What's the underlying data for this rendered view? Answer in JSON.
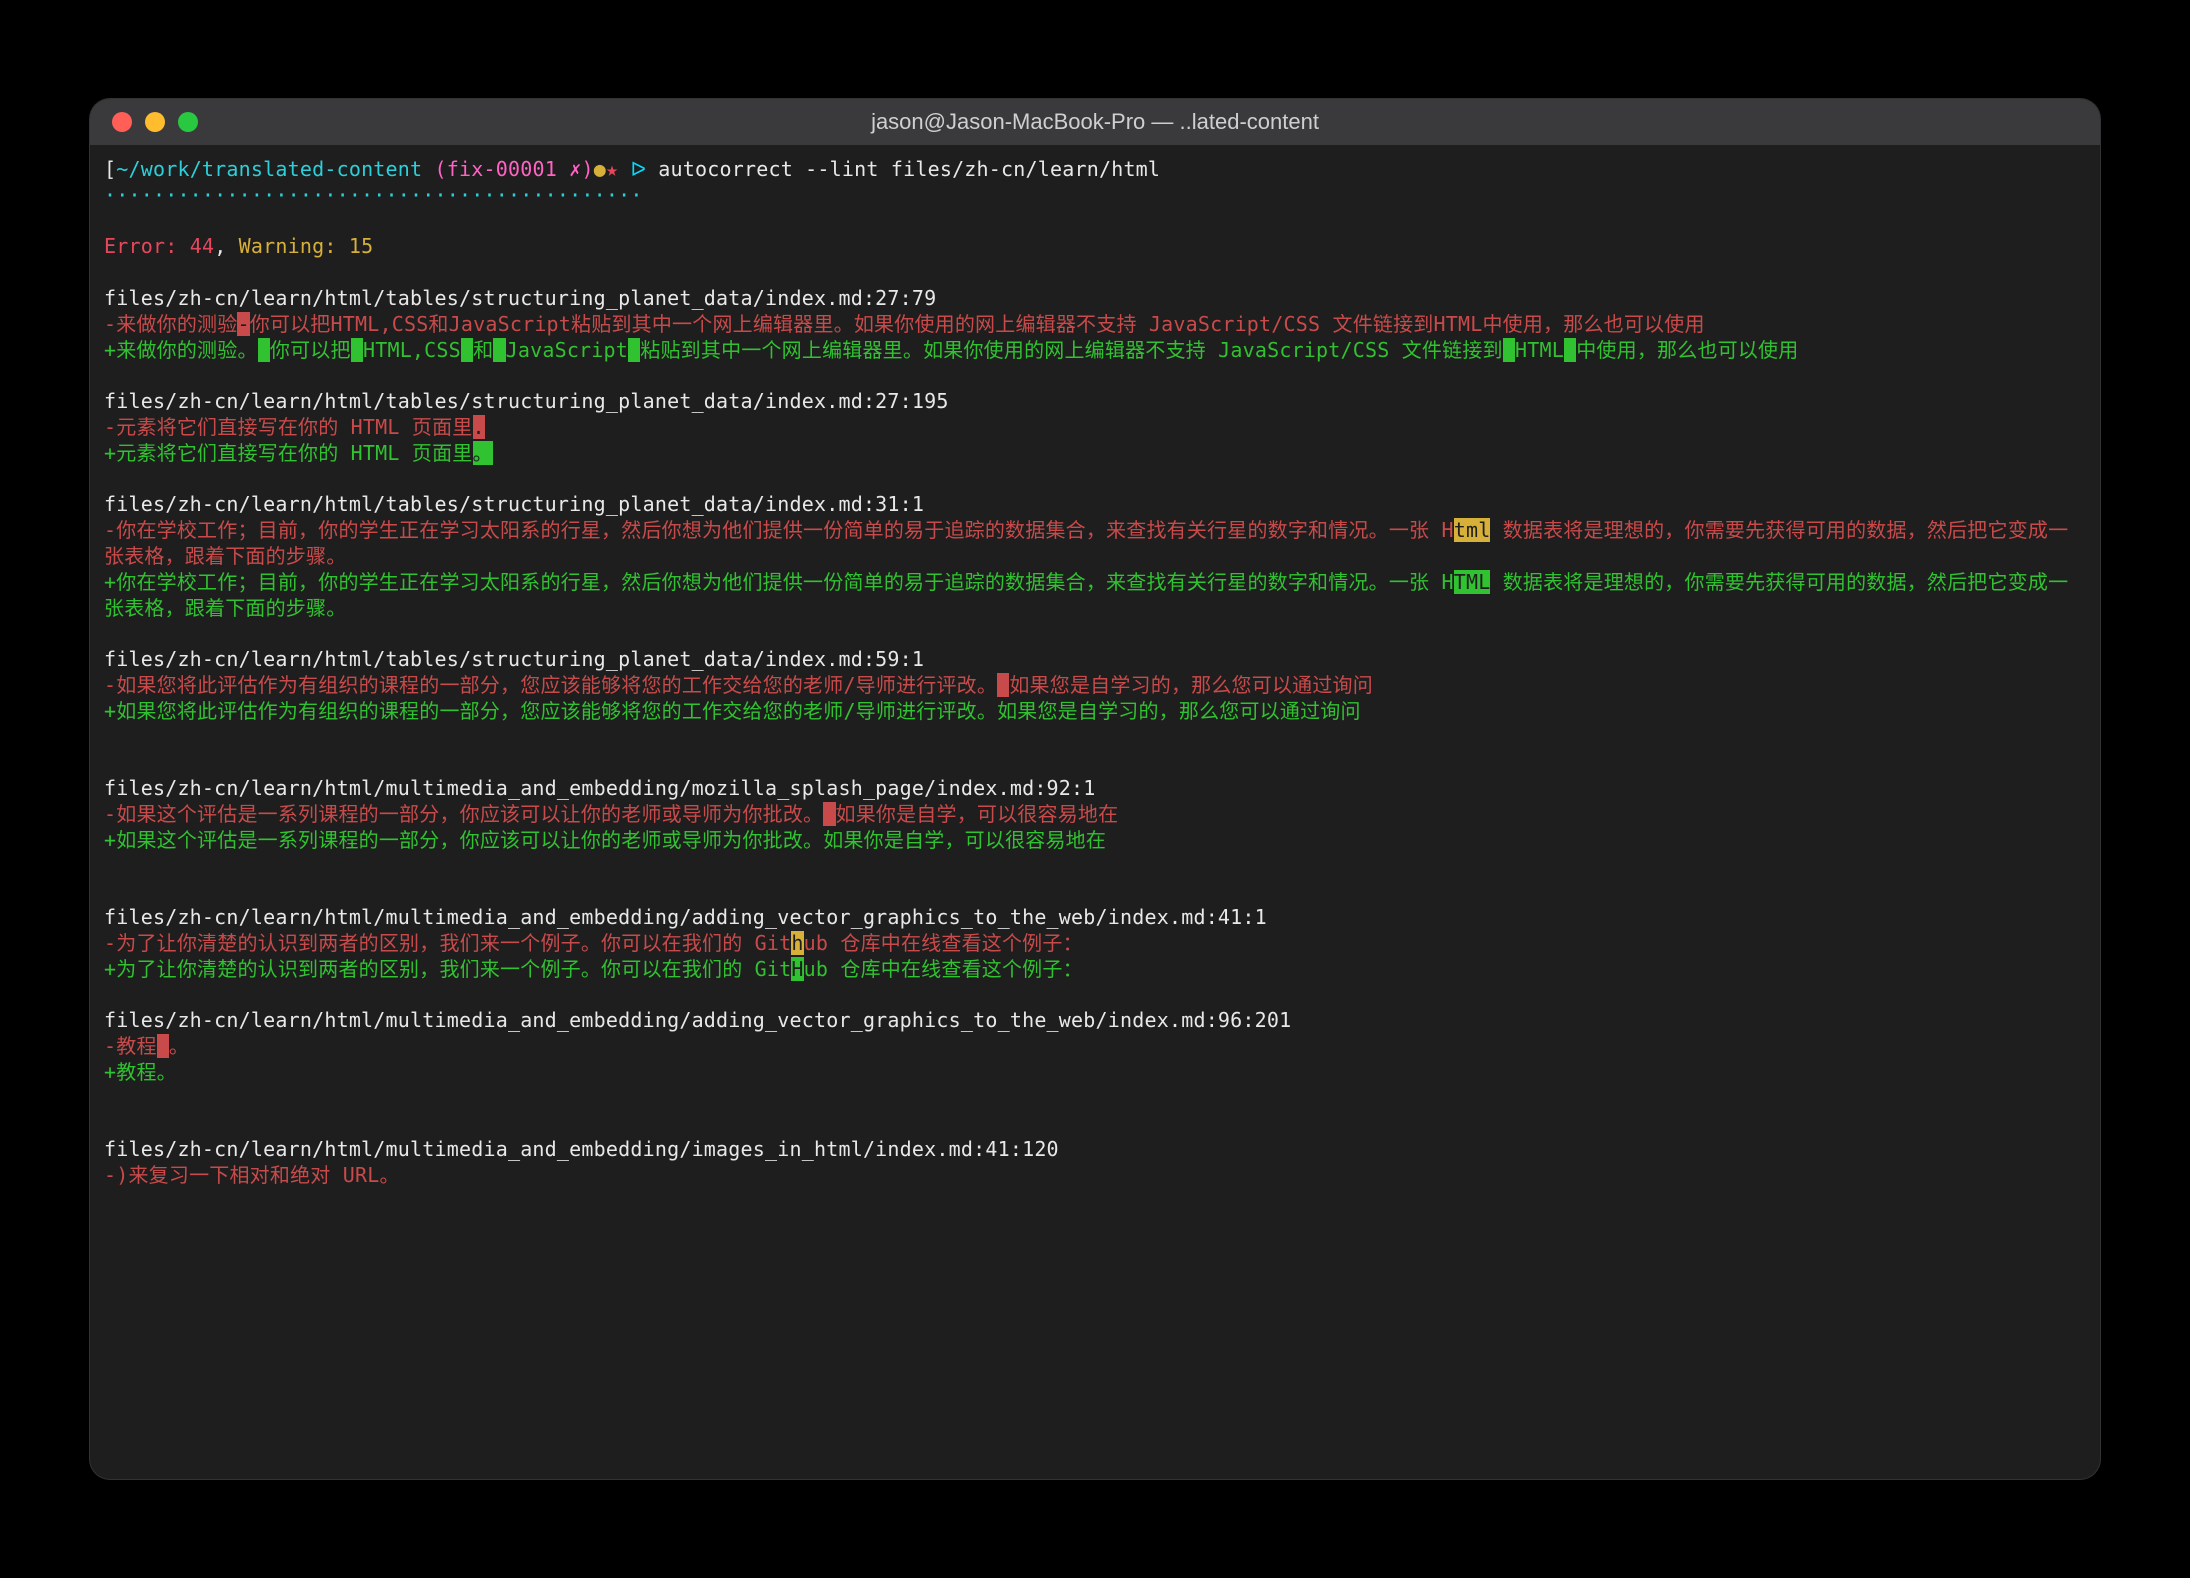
{
  "window": {
    "title": "jason@Jason-MacBook-Pro — ..lated-content"
  },
  "prompt": {
    "path": "~/work/translated-content",
    "branch": "(fix-00001 ",
    "x": "✗",
    "branch_close": ")",
    "star1": "●",
    "star2": "★",
    "arrow": "ᐅ",
    "command": "autocorrect --lint files/zh-cn/learn/html"
  },
  "dots": "············································",
  "summary": {
    "error_label": "Error:",
    "error_count": "44",
    "comma": ",",
    "warning_label": "Warning:",
    "warning_count": "15"
  },
  "blocks": [
    {
      "file": "files/zh-cn/learn/html/tables/structuring_planet_data/index.md:27:79",
      "del": [
        {
          "t": "-来做你的测验"
        },
        {
          "t": "-",
          "hl": "red"
        },
        {
          "t": "你可以把HTML,CSS和JavaScript粘贴到其中一个网上编辑器里。如果你使用的网上编辑器不支持 JavaScript/CSS 文件链接到HTML中使用，那么也可以使用"
        }
      ],
      "add": [
        {
          "t": "+来做你的测验。"
        },
        {
          "t": " ",
          "hl": "green"
        },
        {
          "t": "你可以把"
        },
        {
          "t": " ",
          "hl": "green"
        },
        {
          "t": "HTML,CSS"
        },
        {
          "t": " ",
          "hl": "green"
        },
        {
          "t": "和"
        },
        {
          "t": " ",
          "hl": "green"
        },
        {
          "t": "JavaScript"
        },
        {
          "t": " ",
          "hl": "green"
        },
        {
          "t": "粘贴到其中一个网上编辑器里。如果你使用的网上编辑器不支持 JavaScript/CSS 文件链接到"
        },
        {
          "t": " ",
          "hl": "green"
        },
        {
          "t": "HTML"
        },
        {
          "t": " ",
          "hl": "green"
        },
        {
          "t": "中使用，那么也可以使用"
        }
      ]
    },
    {
      "file": "files/zh-cn/learn/html/tables/structuring_planet_data/index.md:27:195",
      "del": [
        {
          "t": "-元素将它们直接写在你的 HTML 页面里"
        },
        {
          "t": ".",
          "hl": "red"
        }
      ],
      "add": [
        {
          "t": "+元素将它们直接写在你的 HTML 页面里"
        },
        {
          "t": "。",
          "hl": "green"
        }
      ]
    },
    {
      "file": "files/zh-cn/learn/html/tables/structuring_planet_data/index.md:31:1",
      "del": [
        {
          "t": "-你在学校工作；目前，你的学生正在学习太阳系的行星，然后你想为他们提供一份简单的易于追踪的数据集合，来查找有关行星的数字和情况。一张 H"
        },
        {
          "t": "tml",
          "hl": "yel"
        },
        {
          "t": " 数据表将是理想的，你需要先获得可用的数据，然后把它变成一张表格，跟着下面的步骤。"
        }
      ],
      "add": [
        {
          "t": "+你在学校工作；目前，你的学生正在学习太阳系的行星，然后你想为他们提供一份简单的易于追踪的数据集合，来查找有关行星的数字和情况。一张 H"
        },
        {
          "t": "TML",
          "hl": "green"
        },
        {
          "t": " 数据表将是理想的，你需要先获得可用的数据，然后把它变成一张表格，跟着下面的步骤。"
        }
      ]
    },
    {
      "file": "files/zh-cn/learn/html/tables/structuring_planet_data/index.md:59:1",
      "del": [
        {
          "t": "-如果您将此评估作为有组织的课程的一部分，您应该能够将您的工作交给您的老师/导师进行评改。"
        },
        {
          "t": " ",
          "hl": "red"
        },
        {
          "t": "如果您是自学习的，那么您可以通过询问"
        }
      ],
      "add": [
        {
          "t": "+如果您将此评估作为有组织的课程的一部分，您应该能够将您的工作交给您的老师/导师进行评改。如果您是自学习的，那么您可以通过询问"
        }
      ]
    },
    {
      "file": "files/zh-cn/learn/html/multimedia_and_embedding/mozilla_splash_page/index.md:92:1",
      "del": [
        {
          "t": "-如果这个评估是一系列课程的一部分，你应该可以让你的老师或导师为你批改。"
        },
        {
          "t": " ",
          "hl": "red"
        },
        {
          "t": "如果你是自学，可以很容易地在"
        }
      ],
      "add": [
        {
          "t": "+如果这个评估是一系列课程的一部分，你应该可以让你的老师或导师为你批改。如果你是自学，可以很容易地在"
        }
      ]
    },
    {
      "file": "files/zh-cn/learn/html/multimedia_and_embedding/adding_vector_graphics_to_the_web/index.md:41:1",
      "del": [
        {
          "t": "-为了让你清楚的认识到两者的区别，我们来一个例子。你可以在我们的 Git"
        },
        {
          "t": "h",
          "hl": "yel"
        },
        {
          "t": "ub 仓库中在线查看这个例子："
        }
      ],
      "add": [
        {
          "t": "+为了让你清楚的认识到两者的区别，我们来一个例子。你可以在我们的 Git"
        },
        {
          "t": "H",
          "hl": "green"
        },
        {
          "t": "ub 仓库中在线查看这个例子："
        }
      ]
    },
    {
      "file": "files/zh-cn/learn/html/multimedia_and_embedding/adding_vector_graphics_to_the_web/index.md:96:201",
      "del": [
        {
          "t": "-教程"
        },
        {
          "t": " ",
          "hl": "red"
        },
        {
          "t": "。"
        }
      ],
      "add": [
        {
          "t": "+教程。"
        }
      ]
    },
    {
      "file": "files/zh-cn/learn/html/multimedia_and_embedding/images_in_html/index.md:41:120",
      "del": [
        {
          "t": "-)来复习一下相对和绝对 URL。"
        }
      ],
      "add": []
    }
  ]
}
